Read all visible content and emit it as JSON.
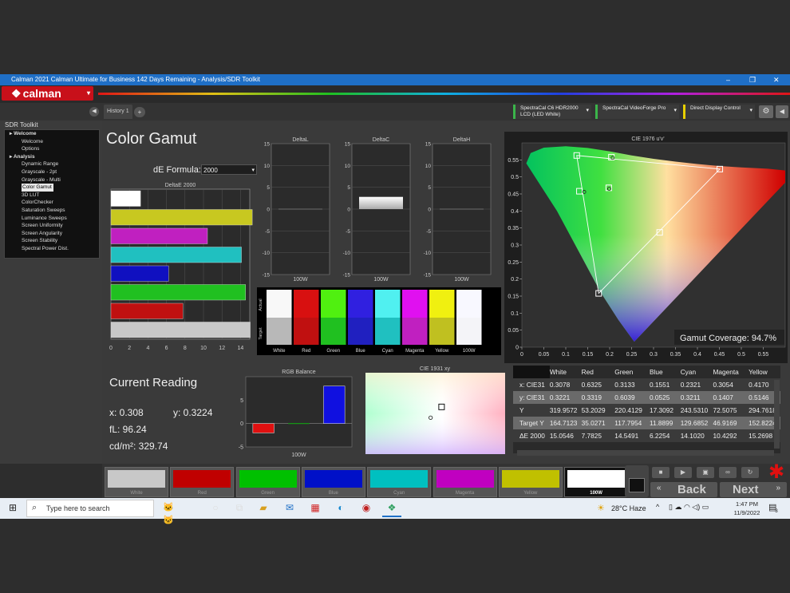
{
  "window": {
    "title": "Calman 2021 Calman Ultimate for Business 142 Days Remaining  - Analysis/SDR Toolkit",
    "minimize": "–",
    "maximize": "❐",
    "close": "✕"
  },
  "logo": {
    "text": "calman"
  },
  "tabs": {
    "history": "History 1",
    "add": "+"
  },
  "devices": [
    {
      "label": "SpectraCal C6 HDR2000 LCD (LED White)",
      "accent": "#3bb54a"
    },
    {
      "label": "SpectraCal VideoForge Pro",
      "accent": "#3bb54a"
    },
    {
      "label": "Direct Display Control",
      "accent": "#e8d000"
    }
  ],
  "sidebar": {
    "title": "SDR Toolkit",
    "tree": [
      {
        "label": "Welcome",
        "level": 0,
        "bold": true
      },
      {
        "label": "Welcome",
        "level": 1
      },
      {
        "label": "Options",
        "level": 1
      },
      {
        "label": "Analysis",
        "level": 0,
        "bold": true
      },
      {
        "label": "Dynamic Range",
        "level": 1
      },
      {
        "label": "Grayscale - 2pt",
        "level": 1
      },
      {
        "label": "Grayscale - Multi",
        "level": 1
      },
      {
        "label": "Color Gamut",
        "level": 1,
        "selected": true
      },
      {
        "label": "3D LUT",
        "level": 1
      },
      {
        "label": "ColorChecker",
        "level": 1
      },
      {
        "label": "Saturation Sweeps",
        "level": 1
      },
      {
        "label": "Luminance Sweeps",
        "level": 1
      },
      {
        "label": "Screen Uniformity",
        "level": 1
      },
      {
        "label": "Screen Angularity",
        "level": 1
      },
      {
        "label": "Screen Stability",
        "level": 1
      },
      {
        "label": "Spectral Power Dist.",
        "level": 1
      }
    ]
  },
  "main": {
    "title": "Color Gamut",
    "de_formula_label": "dE Formula:",
    "de_formula_value": "2000",
    "current_reading": {
      "title": "Current Reading",
      "x": "x: 0.308",
      "y": "y: 0.3224",
      "fl": "fL: 96.24",
      "cdm2": "cd/m²: 329.74"
    }
  },
  "chart_data": [
    {
      "type": "bar",
      "orientation": "horizontal",
      "title": "DeltaE 2000",
      "categories": [
        "White",
        "Yellow",
        "Magenta",
        "Cyan",
        "Blue",
        "Green",
        "Red",
        "100W"
      ],
      "values": [
        3.2,
        15.27,
        10.43,
        14.1,
        6.23,
        14.55,
        7.78,
        15.05
      ],
      "colors": [
        "#ffffff",
        "#c8c820",
        "#c020c0",
        "#20c0c0",
        "#1010c0",
        "#20c020",
        "#c01010",
        "#c8c8c8"
      ],
      "xlim": [
        0,
        15
      ],
      "xticks": [
        0,
        2,
        4,
        6,
        8,
        10,
        12,
        14
      ]
    },
    {
      "type": "bar",
      "title": "DeltaL",
      "categories": [
        "100W"
      ],
      "values": [
        0
      ],
      "ylim": [
        -15,
        15
      ],
      "yticks": [
        15,
        10,
        5,
        0,
        -5,
        -10,
        -15
      ],
      "ytick_labels": [
        "15",
        "10",
        "5",
        "0",
        "-5",
        "-10",
        "-15"
      ]
    },
    {
      "type": "bar",
      "title": "DeltaC",
      "categories": [
        "100W"
      ],
      "values": [
        2.8
      ],
      "ylim": [
        -15,
        15
      ],
      "yticks": [
        15,
        10,
        5,
        0,
        -5,
        -10,
        -15
      ],
      "ytick_labels": [
        "15",
        "10",
        "5",
        "0",
        "-5",
        "-10",
        "-15"
      ]
    },
    {
      "type": "bar",
      "title": "DeltaH",
      "categories": [
        "100W"
      ],
      "values": [
        0
      ],
      "ylim": [
        -15,
        15
      ],
      "yticks": [
        15,
        10,
        5,
        0,
        -5,
        -10,
        -15
      ],
      "ytick_labels": [
        "15",
        "10",
        "5",
        "0",
        "-5",
        "-10",
        "-15"
      ]
    },
    {
      "type": "table",
      "title": "Actual / Target swatches",
      "row_labels": [
        "Actual",
        "Target"
      ],
      "columns": [
        "White",
        "Red",
        "Green",
        "Blue",
        "Cyan",
        "Magenta",
        "Yellow",
        "100W"
      ],
      "actual": [
        "#f8f8f8",
        "#d81010",
        "#50f010",
        "#3020e0",
        "#50f0f0",
        "#e010f0",
        "#f0f010",
        "#f8f8ff"
      ],
      "target": [
        "#b8b8b8",
        "#c01010",
        "#20c020",
        "#2020c0",
        "#20c0c0",
        "#c020c0",
        "#c0c020",
        "#f4f4f8"
      ]
    },
    {
      "type": "scatter",
      "title": "CIE 1976 u'v'",
      "xlim": [
        0,
        0.6
      ],
      "ylim": [
        0,
        0.6
      ],
      "xticks": [
        0,
        0.05,
        0.1,
        0.15,
        0.2,
        0.25,
        0.3,
        0.35,
        0.4,
        0.45,
        0.5,
        0.55
      ],
      "yticks": [
        0,
        0.05,
        0.1,
        0.15,
        0.2,
        0.25,
        0.3,
        0.35,
        0.4,
        0.45,
        0.5,
        0.55
      ],
      "xtick_labels": [
        "0",
        "0.05",
        "0.1",
        "0.15",
        "0.2",
        "0.25",
        "0.3",
        "0.35",
        "0.4",
        "0.45",
        "0.5",
        "0.55"
      ],
      "ytick_labels": [
        "0",
        "0.05",
        "0.1",
        "0.15",
        "0.2",
        "0.25",
        "0.3",
        "0.35",
        "0.4",
        "0.45",
        "0.5",
        "0.55"
      ],
      "targets": [
        {
          "u": 0.451,
          "v": 0.523
        },
        {
          "u": 0.125,
          "v": 0.563
        },
        {
          "u": 0.175,
          "v": 0.158
        },
        {
          "u": 0.198,
          "v": 0.468
        },
        {
          "u": 0.131,
          "v": 0.458
        },
        {
          "u": 0.314,
          "v": 0.337
        },
        {
          "u": 0.204,
          "v": 0.558
        }
      ],
      "actuals": [
        {
          "u": 0.199,
          "v": 0.465
        },
        {
          "u": 0.142,
          "v": 0.456
        },
        {
          "u": 0.207,
          "v": 0.556
        }
      ],
      "gamut_coverage": "Gamut Coverage:  94.7%"
    },
    {
      "type": "bar",
      "title": "RGB Balance",
      "categories": [
        "R",
        "G",
        "B"
      ],
      "values": [
        -2,
        0,
        8
      ],
      "colors": [
        "#e01010",
        "#10a010",
        "#1010e0"
      ],
      "ylim": [
        -5,
        10
      ],
      "yticks": [
        5,
        0,
        -5
      ],
      "ytick_labels": [
        "5",
        "0",
        "-5"
      ],
      "xlabel": "100W"
    },
    {
      "type": "scatter",
      "title": "CIE 1931 xy",
      "target": {
        "x": 0.3127,
        "y": 0.329
      },
      "actual": {
        "x": 0.308,
        "y": 0.3224
      }
    }
  ],
  "reading_table": {
    "columns": [
      "",
      "White",
      "Red",
      "Green",
      "Blue",
      "Cyan",
      "Magenta",
      "Yellow"
    ],
    "rows": [
      [
        "x: CIE31",
        "0.3078",
        "0.6325",
        "0.3133",
        "0.1551",
        "0.2321",
        "0.3054",
        "0.4170"
      ],
      [
        "y: CIE31",
        "0.3221",
        "0.3319",
        "0.6039",
        "0.0525",
        "0.3211",
        "0.1407",
        "0.5146"
      ],
      [
        "Y",
        "319.9572",
        "53.2029",
        "220.4129",
        "17.3092",
        "243.5310",
        "72.5075",
        "294.7618"
      ],
      [
        "Target Y",
        "164.7123",
        "35.0271",
        "117.7954",
        "11.8899",
        "129.6852",
        "46.9169",
        "152.8224"
      ],
      [
        "ΔE 2000",
        "15.0546",
        "7.7825",
        "14.5491",
        "6.2254",
        "14.1020",
        "10.4292",
        "15.2698"
      ]
    ]
  },
  "swatches": [
    {
      "name": "White",
      "color": "#c8c8c8"
    },
    {
      "name": "Red",
      "color": "#c00000"
    },
    {
      "name": "Green",
      "color": "#00c000"
    },
    {
      "name": "Blue",
      "color": "#0010c8"
    },
    {
      "name": "Cyan",
      "color": "#00c0c0"
    },
    {
      "name": "Magenta",
      "color": "#c000c0"
    },
    {
      "name": "Yellow",
      "color": "#c0c000"
    },
    {
      "name": "100W",
      "color": "#ffffff"
    }
  ],
  "nav": {
    "back": "Back",
    "next": "Next"
  },
  "taskbar": {
    "search_placeholder": "Type here to search",
    "weather": "28°C  Haze",
    "time": "1:47 PM",
    "date": "11/9/2022",
    "notifications": "3"
  }
}
